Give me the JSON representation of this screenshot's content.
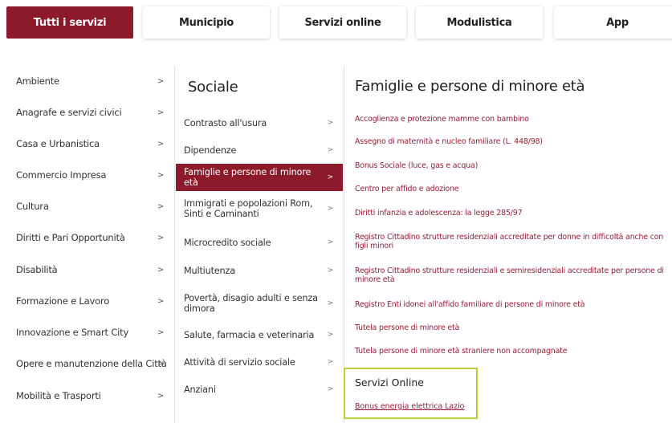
{
  "tabs": [
    {
      "label": "Tutti i servizi",
      "active": true
    },
    {
      "label": "Municipio",
      "active": false
    },
    {
      "label": "Servizi online",
      "active": false
    },
    {
      "label": "Modulistica",
      "active": false
    },
    {
      "label": "App",
      "active": false
    }
  ],
  "categories": [
    {
      "label": "Ambiente",
      "chevron": ">"
    },
    {
      "label": "Anagrafe e servizi civici",
      "chevron": ">"
    },
    {
      "label": "Casa e Urbanistica",
      "chevron": ">"
    },
    {
      "label": "Commercio Impresa",
      "chevron": ">"
    },
    {
      "label": "Cultura",
      "chevron": ">"
    },
    {
      "label": "Diritti e Pari Opportunità",
      "chevron": ">"
    },
    {
      "label": "Disabilità",
      "chevron": ">"
    },
    {
      "label": "Formazione e Lavoro",
      "chevron": ">"
    },
    {
      "label": "Innovazione e Smart City",
      "chevron": ">"
    },
    {
      "label": "Opere e manutenzione della Città",
      "chevron": ">"
    },
    {
      "label": "Mobilità e Trasporti",
      "chevron": ">"
    }
  ],
  "sociale": {
    "title": "Sociale",
    "items": [
      {
        "label": "Contrasto all'usura",
        "chevron": ">"
      },
      {
        "label": "Dipendenze",
        "chevron": ">"
      },
      {
        "label": "Famiglie e persone di minore età",
        "chevron": ">",
        "active": true
      },
      {
        "label": "Immigrati e popolazioni Rom, Sinti e Caminanti",
        "chevron": ">"
      },
      {
        "label": "Microcredito sociale",
        "chevron": ">"
      },
      {
        "label": "Multiutenza",
        "chevron": ">"
      },
      {
        "label": "Povertà, disagio adulti e senza dimora",
        "chevron": ">"
      },
      {
        "label": "Salute, farmacia e veterinaria",
        "chevron": ">"
      },
      {
        "label": "Attività di servizio sociale",
        "chevron": ">"
      },
      {
        "label": "Anziani",
        "chevron": ">"
      }
    ]
  },
  "famiglie": {
    "title": "Famiglie e persone di minore età",
    "links": [
      "Accoglienza e protezione mamme con bambino",
      "Assegno di maternità e nucleo familiare (L. 448/98)",
      "Bonus Sociale (luce, gas e acqua)",
      "Centro per affido e adozione",
      "Diritti infanzia e adolescenza: la legge 285/97",
      "Registro Cittadino strutture residenziali accreditate per donne in difficoltà anche con figli minori",
      "Registro Cittadino strutture residenziali e semiresidenziali accreditate per persone di minore età",
      "Registro Enti idonei all'affido familiare di persone di minore età",
      "Tutela persone di minore età",
      "Tutela persone di minore età straniere non accompagnate"
    ]
  },
  "servizi_online": {
    "title": "Servizi Online",
    "link": "Bonus energia elettrica Lazio"
  },
  "colors": {
    "accent": "#8c1a2a",
    "link": "#9b1b33",
    "highlight_border": "#b3d33a"
  }
}
